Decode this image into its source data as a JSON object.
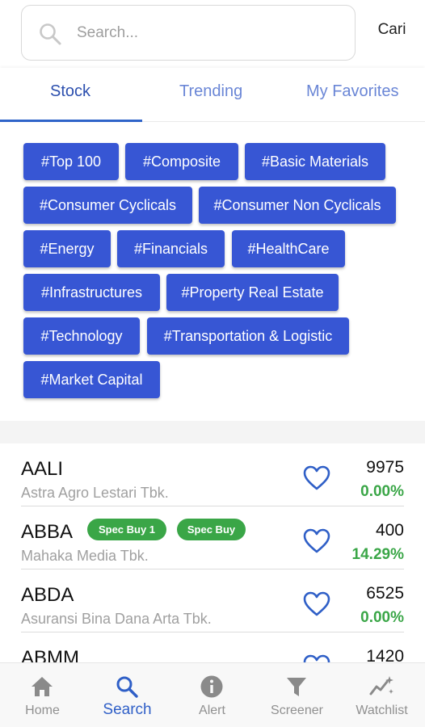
{
  "search": {
    "placeholder": "Search...",
    "submit_label": "Cari"
  },
  "tabs": [
    {
      "label": "Stock",
      "active": true
    },
    {
      "label": "Trending",
      "active": false
    },
    {
      "label": "My Favorites",
      "active": false
    }
  ],
  "tags": [
    "#Top 100",
    "#Composite",
    "#Basic Materials",
    "#Consumer Cyclicals",
    "#Consumer Non Cyclicals",
    "#Energy",
    "#Financials",
    "#HealthCare",
    "#Infrastructures",
    "#Property Real Estate",
    "#Technology",
    "#Transportation & Logistic",
    "#Market Capital"
  ],
  "stocks": [
    {
      "code": "AALI",
      "name": "Astra Agro Lestari Tbk.",
      "price": "9975",
      "change": "0.00%",
      "badges": []
    },
    {
      "code": "ABBA",
      "name": "Mahaka Media Tbk.",
      "price": "400",
      "change": "14.29%",
      "badges": [
        "Spec Buy 1",
        "Spec Buy"
      ]
    },
    {
      "code": "ABDA",
      "name": "Asuransi Bina Dana Arta Tbk.",
      "price": "6525",
      "change": "0.00%",
      "badges": []
    },
    {
      "code": "ABMM",
      "name": "",
      "price": "1420",
      "change": "",
      "badges": []
    }
  ],
  "bottom_nav": [
    {
      "label": "Home",
      "icon": "home-icon",
      "active": false
    },
    {
      "label": "Search",
      "icon": "search-icon",
      "active": true
    },
    {
      "label": "Alert",
      "icon": "info-icon",
      "active": false
    },
    {
      "label": "Screener",
      "icon": "filter-icon",
      "active": false
    },
    {
      "label": "Watchlist",
      "icon": "chart-sparkle-icon",
      "active": false
    }
  ],
  "colors": {
    "tag_bg": "#3756d4",
    "accent": "#2f5fc7",
    "positive": "#3aa647",
    "heart": "#2f5fc7"
  }
}
